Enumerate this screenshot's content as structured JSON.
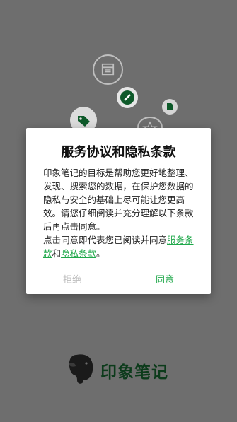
{
  "dialog": {
    "title": "服务协议和隐私条款",
    "body_text": "印象笔记的目标是帮助您更好地整理、发现、搜索您的数据，在保护您数据的隐私与安全的基础上尽可能让您更高效。请您仔细阅读并充分理解以下条款后再点击同意。",
    "consent_prefix": "点击同意即代表您已阅读并同意",
    "terms_link": "服务条款",
    "and_text": "和",
    "privacy_link": "隐私条款",
    "end_punct": "。",
    "reject_label": "拒绝",
    "agree_label": "同意"
  },
  "logo": {
    "text": "印象笔记",
    "icon": "elephant-icon"
  },
  "decorations": {
    "icons": [
      "calendar-icon",
      "pencil-icon",
      "tag-icon",
      "document-icon",
      "star-icon"
    ]
  },
  "colors": {
    "overlay": "#6e6e6e",
    "accent": "#1fa84a",
    "disabled": "#bdbdbd",
    "logo_text": "#0c3b1b"
  }
}
